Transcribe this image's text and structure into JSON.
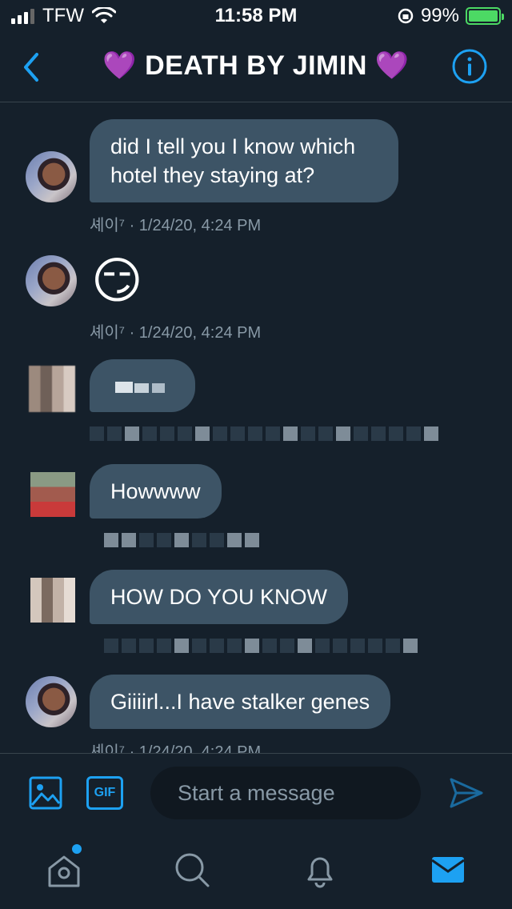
{
  "status": {
    "carrier": "TFW",
    "time": "11:58 PM",
    "battery": "99%"
  },
  "header": {
    "title": "💜 DEATH BY JIMIN 💜"
  },
  "messages": [
    {
      "text": "did I tell you I know which hotel they staying at?",
      "meta": "셰이⁷ · 1/24/20, 4:24 PM"
    },
    {
      "emoji": "😏",
      "meta": "셰이⁷ · 1/24/20, 4:24 PM"
    },
    {
      "text": "Howwww"
    },
    {
      "text": "HOW DO YOU KNOW"
    },
    {
      "text": "Giiiirl...I have stalker genes",
      "meta": "셰이⁷ · 1/24/20, 4:24 PM"
    }
  ],
  "composer": {
    "placeholder": "Start a message",
    "gif_label": "GIF"
  },
  "colors": {
    "background": "#15202b",
    "bubble": "#3d5466",
    "accent": "#1da1f2"
  },
  "icons": [
    "back-chevron-icon",
    "info-icon",
    "image-icon",
    "gif-icon",
    "send-icon",
    "home-icon",
    "search-icon",
    "bell-icon",
    "mail-icon"
  ]
}
